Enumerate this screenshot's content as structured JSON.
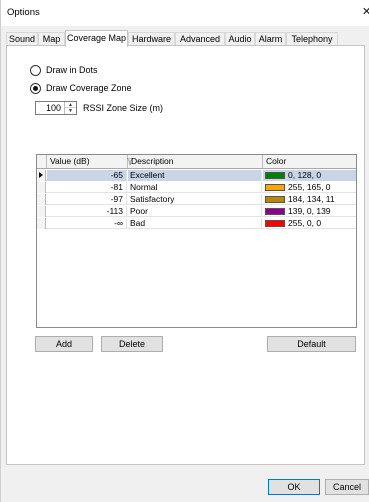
{
  "window": {
    "title": "Options",
    "close_glyph": "✕"
  },
  "tabs": [
    {
      "label": "Sound",
      "active": false
    },
    {
      "label": "Map",
      "active": false
    },
    {
      "label": "Coverage Map",
      "active": true
    },
    {
      "label": "Hardware",
      "active": false
    },
    {
      "label": "Advanced",
      "active": false
    },
    {
      "label": "Audio",
      "active": false
    },
    {
      "label": "Alarm",
      "active": false
    },
    {
      "label": "Telephony",
      "active": false
    }
  ],
  "coverage": {
    "draw_in_dots_label": "Draw in Dots",
    "draw_in_dots_checked": false,
    "draw_zone_label": "Draw Coverage Zone",
    "draw_zone_checked": true,
    "rssi_zone_size": "100",
    "rssi_zone_label": "RSSI Zone Size (m)"
  },
  "grid": {
    "columns": [
      "Value (dB)",
      "Description",
      "Color"
    ],
    "rows": [
      {
        "value": "-65",
        "description": "Excellent",
        "color_text": "0, 128, 0",
        "color": "#008000",
        "selected": true
      },
      {
        "value": "-81",
        "description": "Normal",
        "color_text": "255, 165, 0",
        "color": "#ffa500",
        "selected": false
      },
      {
        "value": "-97",
        "description": "Satisfactory",
        "color_text": "184, 134, 11",
        "color": "#b8860b",
        "selected": false
      },
      {
        "value": "-113",
        "description": "Poor",
        "color_text": "139, 0, 139",
        "color": "#8b008b",
        "selected": false
      },
      {
        "value": "-∞",
        "description": "Bad",
        "color_text": "255, 0, 0",
        "color": "#ff0000",
        "selected": false
      }
    ]
  },
  "buttons": {
    "add": "Add",
    "delete": "Delete",
    "default": "Default",
    "ok": "OK",
    "cancel": "Cancel"
  }
}
